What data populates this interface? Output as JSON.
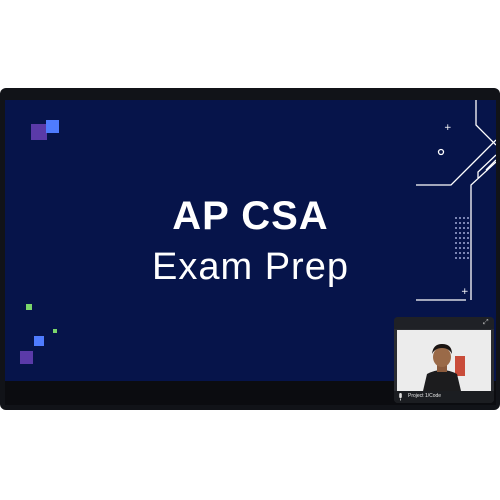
{
  "slide": {
    "title_line1": "AP CSA",
    "title_line2": "Exam Prep"
  },
  "participant": {
    "name": "Project 1/Code"
  },
  "icons": {
    "mic": "mic-icon",
    "expand": "expand-icon"
  },
  "colors": {
    "slide_background": "#06144a",
    "accent_purple": "#5a3aa8",
    "accent_blue": "#4f7cff",
    "accent_green": "#7bd66a"
  }
}
